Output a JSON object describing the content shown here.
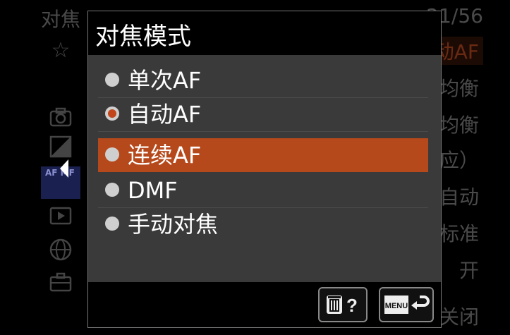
{
  "background": {
    "title": "对焦",
    "page_indicator": "21/56",
    "right_items": [
      "动AF",
      "均衡",
      "均衡",
      "响应）",
      "自动",
      "标准",
      "开",
      "关闭"
    ],
    "left_tab_label": "AF MF",
    "colors": {
      "accent_dim": "#6a2a12",
      "tab_bg": "#1a2050"
    }
  },
  "popup": {
    "title": "对焦模式",
    "options": [
      {
        "label": "单次AF",
        "state": "normal"
      },
      {
        "label": "自动AF",
        "state": "checked"
      },
      {
        "label": "连续AF",
        "state": "highlighted"
      },
      {
        "label": "DMF",
        "state": "normal"
      },
      {
        "label": "手动对焦",
        "state": "normal"
      }
    ],
    "footer": {
      "help_button": {
        "icon": "trash-question-icon",
        "text": "?"
      },
      "back_button": {
        "icon": "menu-return-icon",
        "text": "MENU"
      }
    },
    "colors": {
      "highlight": "#b6491b",
      "body": "#3a3a3a"
    }
  }
}
